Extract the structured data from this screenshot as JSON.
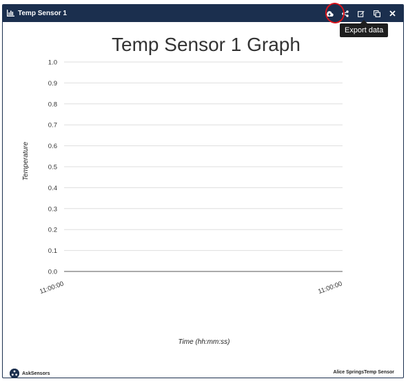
{
  "widget": {
    "title": "Temp Sensor 1",
    "title_icon": "bar-chart-icon",
    "tools": [
      {
        "name": "export-data-button",
        "icon": "cloud-download-icon"
      },
      {
        "name": "share-button",
        "icon": "share-icon"
      },
      {
        "name": "edit-button",
        "icon": "edit-icon"
      },
      {
        "name": "duplicate-button",
        "icon": "copy-icon"
      },
      {
        "name": "close-button",
        "icon": "close-icon"
      }
    ],
    "tooltip": "Export data",
    "annotation_color": "#d8141c",
    "header_color": "#1b2f4e"
  },
  "chart_data": {
    "type": "line",
    "title": "Temp Sensor 1 Graph",
    "xlabel": "Time (hh:mm:ss)",
    "ylabel": "Temperature",
    "ylim": [
      0,
      1
    ],
    "yticks": [
      "0.0",
      "0.1",
      "0.2",
      "0.3",
      "0.4",
      "0.5",
      "0.6",
      "0.7",
      "0.8",
      "0.9",
      "1.0"
    ],
    "xticks": [
      "11:00:00",
      "11:00:00"
    ],
    "series": [],
    "grid": true
  },
  "footer": {
    "left_label": "AskSensors",
    "right_label": "Alice SpringsTemp Sensor"
  }
}
